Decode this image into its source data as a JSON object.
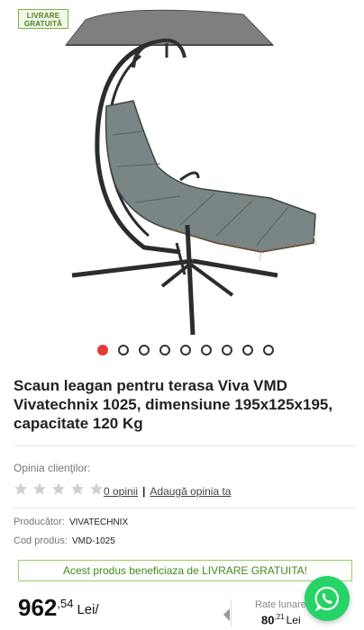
{
  "badge": {
    "line1": "LIVRARE",
    "line2": "GRATUITĂ"
  },
  "gallery": {
    "total_images": 9,
    "active_index": 0
  },
  "product": {
    "title": "Scaun leagan pentru terasa Viva VMD Vivatechnix 1025, dimensiune 195x125x195, capacitate 120 Kg"
  },
  "reviews": {
    "label": "Opinia clienţilor:",
    "rating": 0,
    "max_rating": 5,
    "count_link": "0 opinii",
    "separator": "|",
    "add_link": "Adaugă opinia ta"
  },
  "meta": {
    "producer_label": "Producător:",
    "producer_value": "VIVATECHNIX",
    "code_label": "Cod produs:",
    "code_value": "VMD-1025"
  },
  "free_shipping": "Acest produs beneficiaza de LIVRARE GRATUITA!",
  "price": {
    "integer": "962",
    "decimal": ",54",
    "currency": "Lei/"
  },
  "installment": {
    "label": "Rate lunare",
    "integer": "80",
    "decimal": ",21",
    "currency": "Lei"
  },
  "colors": {
    "accent_red": "#e53935",
    "free_green": "#3f8a1a",
    "whatsapp": "#25d366"
  },
  "icons": {
    "whatsapp": "whatsapp-icon",
    "star": "star-icon",
    "info": "info-icon"
  }
}
